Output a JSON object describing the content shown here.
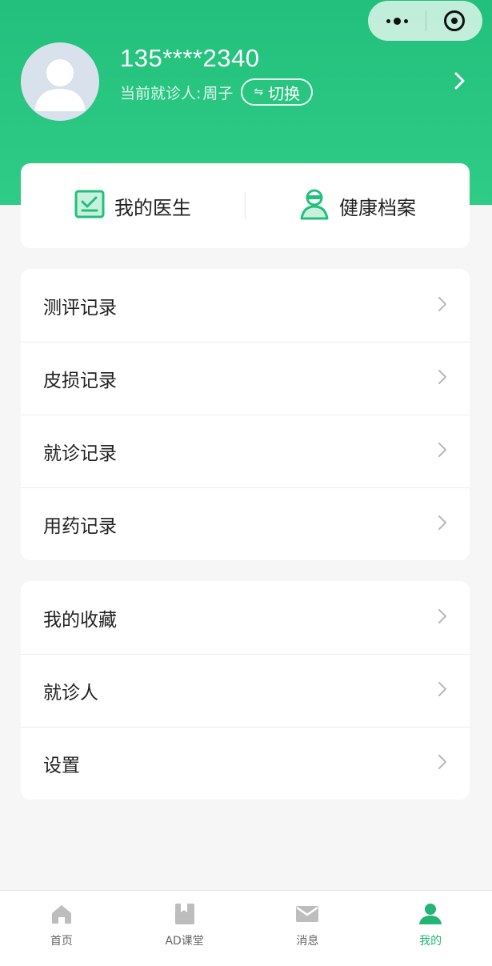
{
  "colors": {
    "brand": "#22c07c",
    "active_tab": "#22b573",
    "background": "#f6f6f6",
    "avatar_bg": "#d9e1ec"
  },
  "capsule": {
    "more_icon": "more-dots-icon",
    "close_icon": "target-close-icon"
  },
  "profile": {
    "phone": "135****2340",
    "patient_label": "当前就诊人:",
    "patient_name": "周子",
    "switch_label": "切换",
    "avatar_icon": "user-avatar-icon"
  },
  "quick": {
    "items": [
      {
        "label": "我的医生",
        "icon": "doctor-check-icon"
      },
      {
        "label": "健康档案",
        "icon": "health-record-icon"
      }
    ]
  },
  "records": {
    "items": [
      {
        "label": "测评记录"
      },
      {
        "label": "皮损记录"
      },
      {
        "label": "就诊记录"
      },
      {
        "label": "用药记录"
      }
    ]
  },
  "others": {
    "items": [
      {
        "label": "我的收藏"
      },
      {
        "label": "就诊人"
      },
      {
        "label": "设置"
      }
    ]
  },
  "tabbar": {
    "tabs": [
      {
        "label": "首页",
        "icon": "home-icon"
      },
      {
        "label": "AD课堂",
        "icon": "book-icon"
      },
      {
        "label": "消息",
        "icon": "mail-icon"
      },
      {
        "label": "我的",
        "icon": "person-icon",
        "active": true
      }
    ]
  }
}
